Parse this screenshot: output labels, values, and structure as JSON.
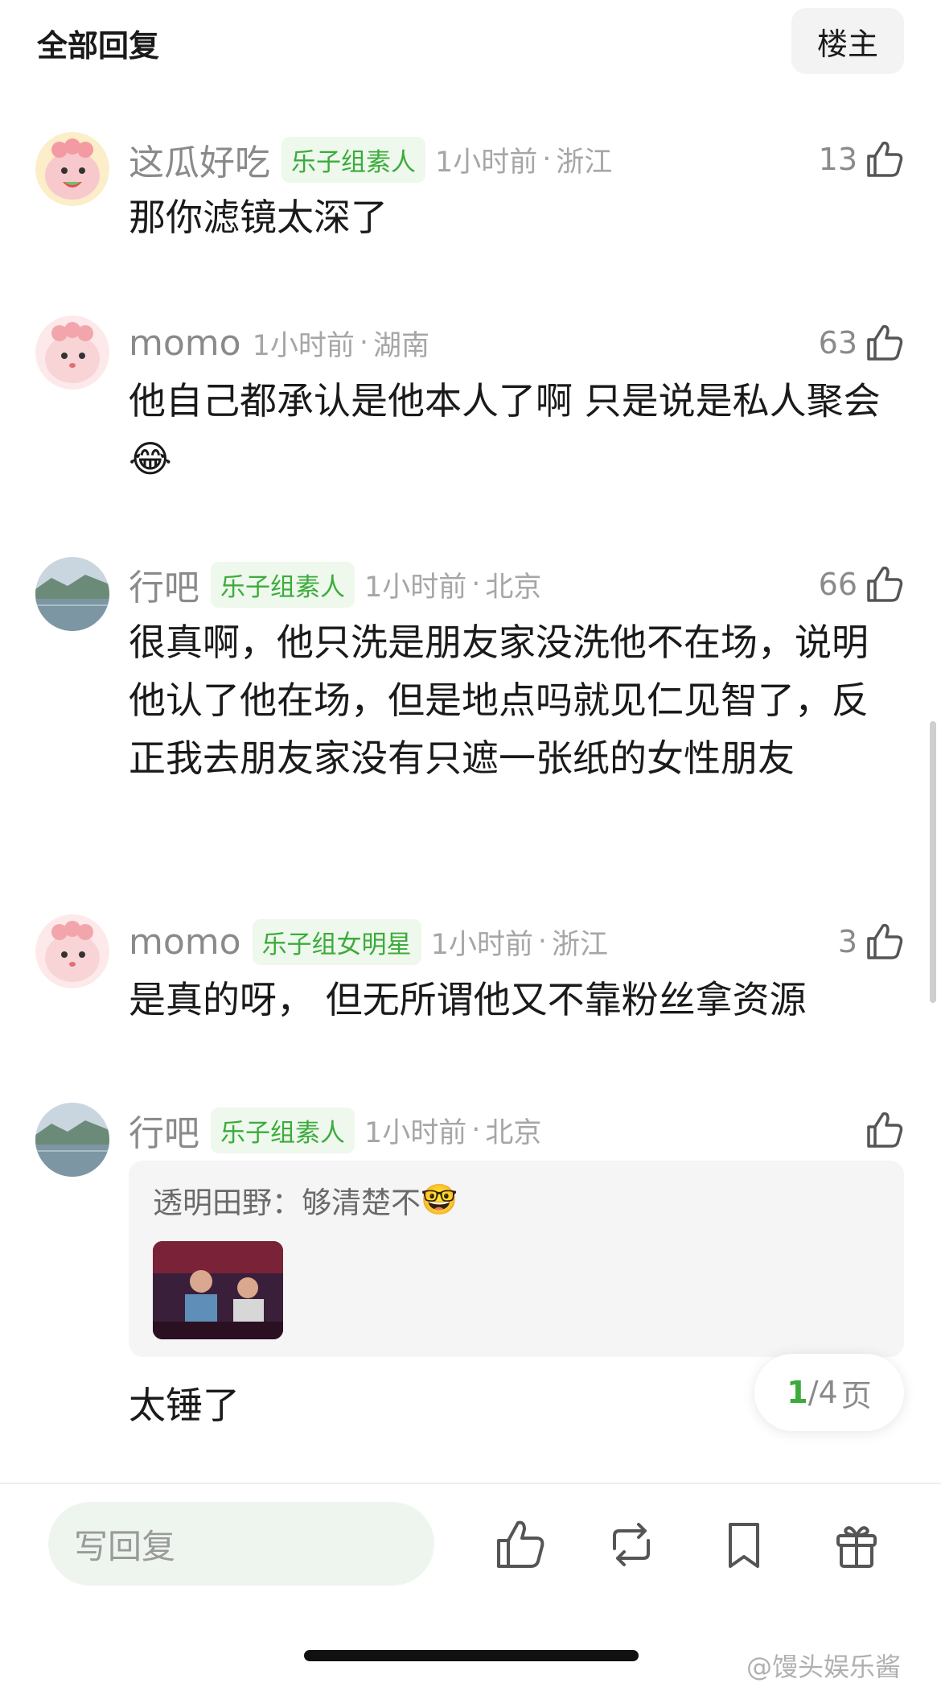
{
  "header": {
    "title": "全部回复",
    "owner_button": "楼主"
  },
  "comments": [
    {
      "username": "这瓜好吃",
      "badge": "乐子组素人",
      "time": "1小时前",
      "location": "浙江",
      "likes": "13",
      "text": "那你滤镜太深了",
      "avatar": "cartoon-watermelon"
    },
    {
      "username": "momo",
      "badge": "",
      "time": "1小时前",
      "location": "湖南",
      "likes": "63",
      "text": "他自己都承认是他本人了啊 只是说是私人聚会",
      "emoji": "😂",
      "avatar": "cartoon-pink"
    },
    {
      "username": "行吧",
      "badge": "乐子组素人",
      "time": "1小时前",
      "location": "北京",
      "likes": "66",
      "text": "很真啊，他只洗是朋友家没洗他不在场，说明他认了他在场，但是地点吗就见仁见智了，反正我去朋友家没有只遮一张纸的女性朋友",
      "avatar": "landscape-lake"
    },
    {
      "username": "momo",
      "badge": "乐子组女明星",
      "time": "1小时前",
      "location": "浙江",
      "likes": "3",
      "text": "是真的呀， 但无所谓他又不靠粉丝拿资源",
      "avatar": "cartoon-pink"
    },
    {
      "username": "行吧",
      "badge": "乐子组素人",
      "time": "1小时前",
      "location": "北京",
      "likes": "",
      "quote": {
        "author": "透明田野：",
        "text": "够清楚不",
        "emoji": "🤓"
      },
      "text": "太锤了",
      "avatar": "landscape-lake"
    }
  ],
  "separator": "·",
  "pagination": {
    "current": "1",
    "total": "/4",
    "unit": "页"
  },
  "bottom_bar": {
    "reply_placeholder": "写回复"
  },
  "watermark": "@馒头娱乐酱",
  "icons": [
    "thumbs-up-icon",
    "repost-icon",
    "bookmark-icon",
    "gift-icon"
  ],
  "colors": {
    "accent_green": "#3cab3c",
    "badge_bg": "#eef8ec",
    "meta_gray": "#a6a6a6"
  }
}
